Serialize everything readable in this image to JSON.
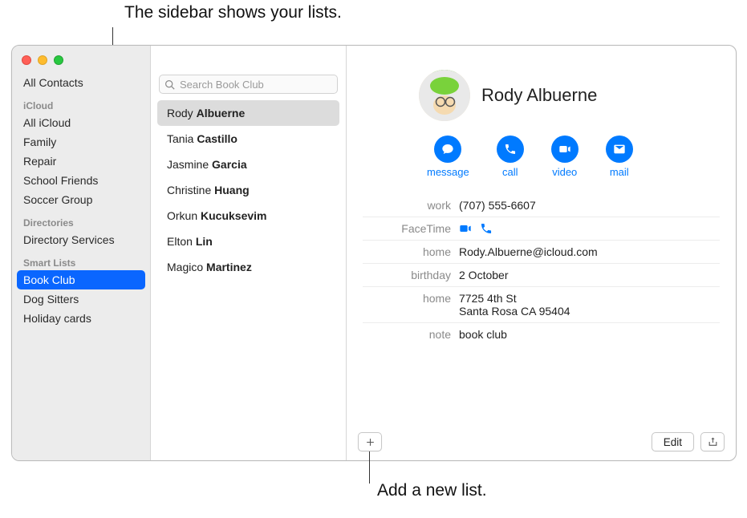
{
  "callouts": {
    "top": "The sidebar shows your lists.",
    "bottom": "Add a new list."
  },
  "sidebar": {
    "all_contacts": "All Contacts",
    "sections": {
      "icloud_header": "iCloud",
      "icloud_items": [
        "All iCloud",
        "Family",
        "Repair",
        "School Friends",
        "Soccer Group"
      ],
      "directories_header": "Directories",
      "directories_items": [
        "Directory Services"
      ],
      "smart_header": "Smart Lists",
      "smart_items": [
        "Book Club",
        "Dog Sitters",
        "Holiday cards"
      ],
      "smart_selected_index": 0
    }
  },
  "search": {
    "placeholder": "Search Book Club"
  },
  "contacts": [
    {
      "first": "Rody",
      "last": "Albuerne",
      "selected": true
    },
    {
      "first": "Tania",
      "last": "Castillo"
    },
    {
      "first": "Jasmine",
      "last": "Garcia"
    },
    {
      "first": "Christine",
      "last": "Huang"
    },
    {
      "first": "Orkun",
      "last": "Kucuksevim"
    },
    {
      "first": "Elton",
      "last": "Lin"
    },
    {
      "first": "Magico",
      "last": "Martinez"
    }
  ],
  "card": {
    "name": "Rody Albuerne",
    "actions": {
      "message": "message",
      "call": "call",
      "video": "video",
      "mail": "mail"
    },
    "fields": [
      {
        "label": "work",
        "value": "(707) 555-6607"
      },
      {
        "label": "FaceTime",
        "value": "",
        "facetime": true
      },
      {
        "label": "home",
        "value": "Rody.Albuerne@icloud.com"
      },
      {
        "label": "birthday",
        "value": "2 October"
      },
      {
        "label": "home",
        "value": "7725 4th St\nSanta Rosa CA 95404"
      },
      {
        "label": "note",
        "value": "book club"
      }
    ],
    "edit_label": "Edit"
  }
}
